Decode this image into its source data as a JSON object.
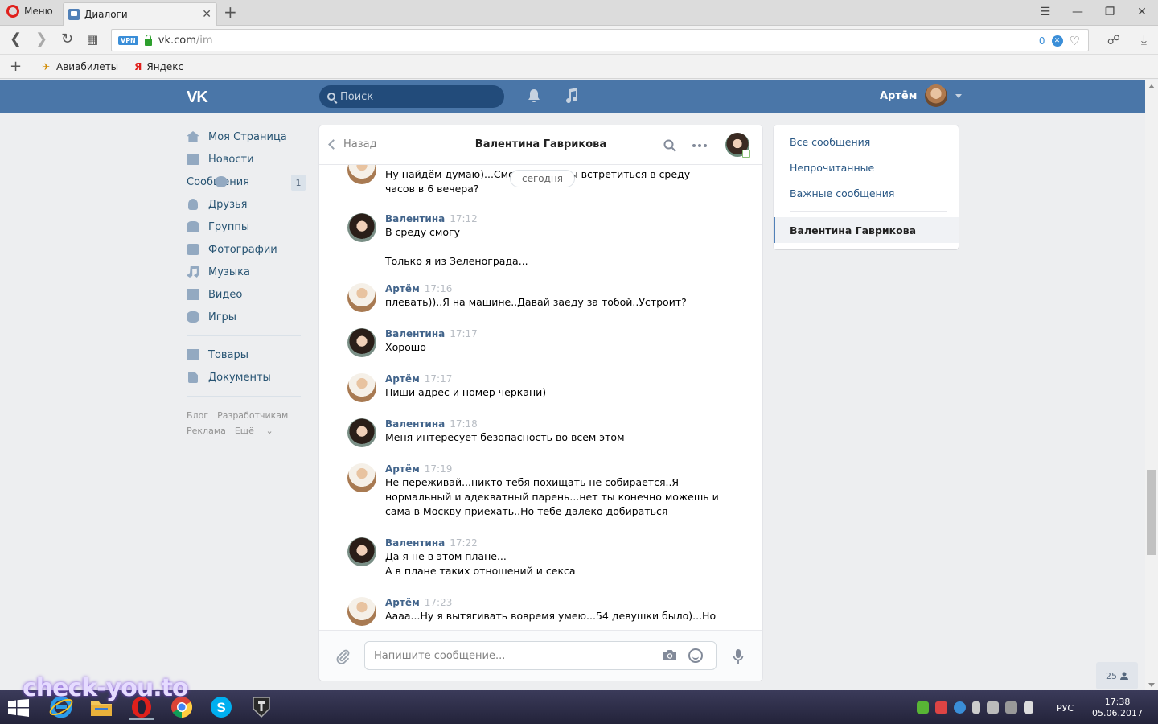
{
  "browser": {
    "menu_label": "Меню",
    "tab_title": "Диалоги",
    "url_host": "vk.com",
    "url_path": "/im",
    "vpn_label": "VPN",
    "adblock_count": "0",
    "bookmarks": [
      {
        "label": "Авиабилеты",
        "icon": "plane-icon"
      },
      {
        "label": "Яндекс",
        "icon": "yandex-icon"
      }
    ]
  },
  "vk_header": {
    "logo": "VK",
    "search_placeholder": "Поиск",
    "user_name": "Артём"
  },
  "left_nav": {
    "items": [
      {
        "label": "Моя Страница",
        "icon": "home-icon"
      },
      {
        "label": "Новости",
        "icon": "news-icon"
      },
      {
        "label": "Сообщения",
        "icon": "messages-icon",
        "badge": "1"
      },
      {
        "label": "Друзья",
        "icon": "friends-icon"
      },
      {
        "label": "Группы",
        "icon": "groups-icon"
      },
      {
        "label": "Фотографии",
        "icon": "photos-icon"
      },
      {
        "label": "Музыка",
        "icon": "music-icon"
      },
      {
        "label": "Видео",
        "icon": "video-icon"
      },
      {
        "label": "Игры",
        "icon": "games-icon"
      }
    ],
    "items2": [
      {
        "label": "Товары",
        "icon": "goods-icon"
      },
      {
        "label": "Документы",
        "icon": "documents-icon"
      }
    ],
    "footer": [
      "Блог",
      "Разработчикам",
      "Реклама",
      "Ещё"
    ]
  },
  "dialog": {
    "back_label": "Назад",
    "title": "Валентина Гаврикова",
    "date_label": "сегодня",
    "input_placeholder": "Напишите сообщение...",
    "messages": [
      {
        "author": "",
        "time": "",
        "text": "Ну найдём думаю)...Сможешь ли ты встретиться в среду\nчасов в 6 вечера?",
        "who": "art"
      },
      {
        "author": "Валентина",
        "time": "17:12",
        "text": "В среду смогу\n\nТолько я из Зеленограда...",
        "who": "val"
      },
      {
        "author": "Артём",
        "time": "17:16",
        "text": "плевать))..Я на машине..Давай заеду за тобой..Устроит?",
        "who": "art"
      },
      {
        "author": "Валентина",
        "time": "17:17",
        "text": "Хорошо",
        "who": "val"
      },
      {
        "author": "Артём",
        "time": "17:17",
        "text": "Пиши адрес и номер черкани)",
        "who": "art"
      },
      {
        "author": "Валентина",
        "time": "17:18",
        "text": "Меня интересует безопасность во всем этом",
        "who": "val"
      },
      {
        "author": "Артём",
        "time": "17:19",
        "text": "Не переживай...никто тебя похищать не собирается..Я\nнормальный и адекватный парень...нет ты конечно можешь и\nсама в Москву приехать..Но тебе далеко добираться",
        "who": "art"
      },
      {
        "author": "Валентина",
        "time": "17:22",
        "text": "Да я не в этом плане...\nА в плане таких отношений и секса",
        "who": "val"
      },
      {
        "author": "Артём",
        "time": "17:23",
        "text": "Аааа...Ну я вытягивать вовремя умею...54 девушки было)...Но",
        "who": "art"
      }
    ]
  },
  "filters": {
    "items": [
      "Все сообщения",
      "Непрочитанные",
      "Важные сообщения"
    ],
    "active": "Валентина Гаврикова"
  },
  "online_count": "25",
  "taskbar": {
    "lang": "РУС",
    "time": "17:38",
    "date": "05.06.2017"
  },
  "watermark": "check-you.to",
  "colors": {
    "vk_blue": "#4a76a8",
    "link": "#2a5885",
    "author": "#42648b"
  }
}
